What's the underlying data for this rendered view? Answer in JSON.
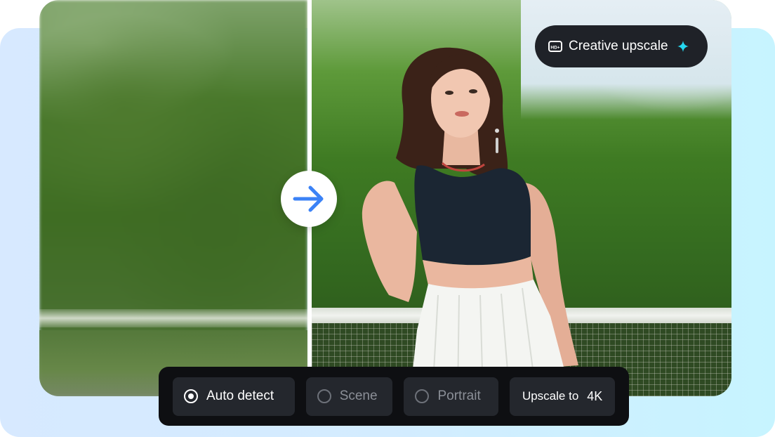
{
  "badge": {
    "label": "Creative upscale",
    "icon": "hd-plus-icon",
    "accent_icon": "sparkle-icon",
    "accent_color": "#25d7f0"
  },
  "compare": {
    "arrow_icon": "arrow-right-icon",
    "arrow_color": "#3b82f6"
  },
  "toolbar": {
    "options": [
      {
        "label": "Auto detect",
        "selected": true
      },
      {
        "label": "Scene",
        "selected": false
      },
      {
        "label": "Portrait",
        "selected": false
      }
    ],
    "upscale_label": "Upscale to",
    "upscale_value": "4K"
  }
}
